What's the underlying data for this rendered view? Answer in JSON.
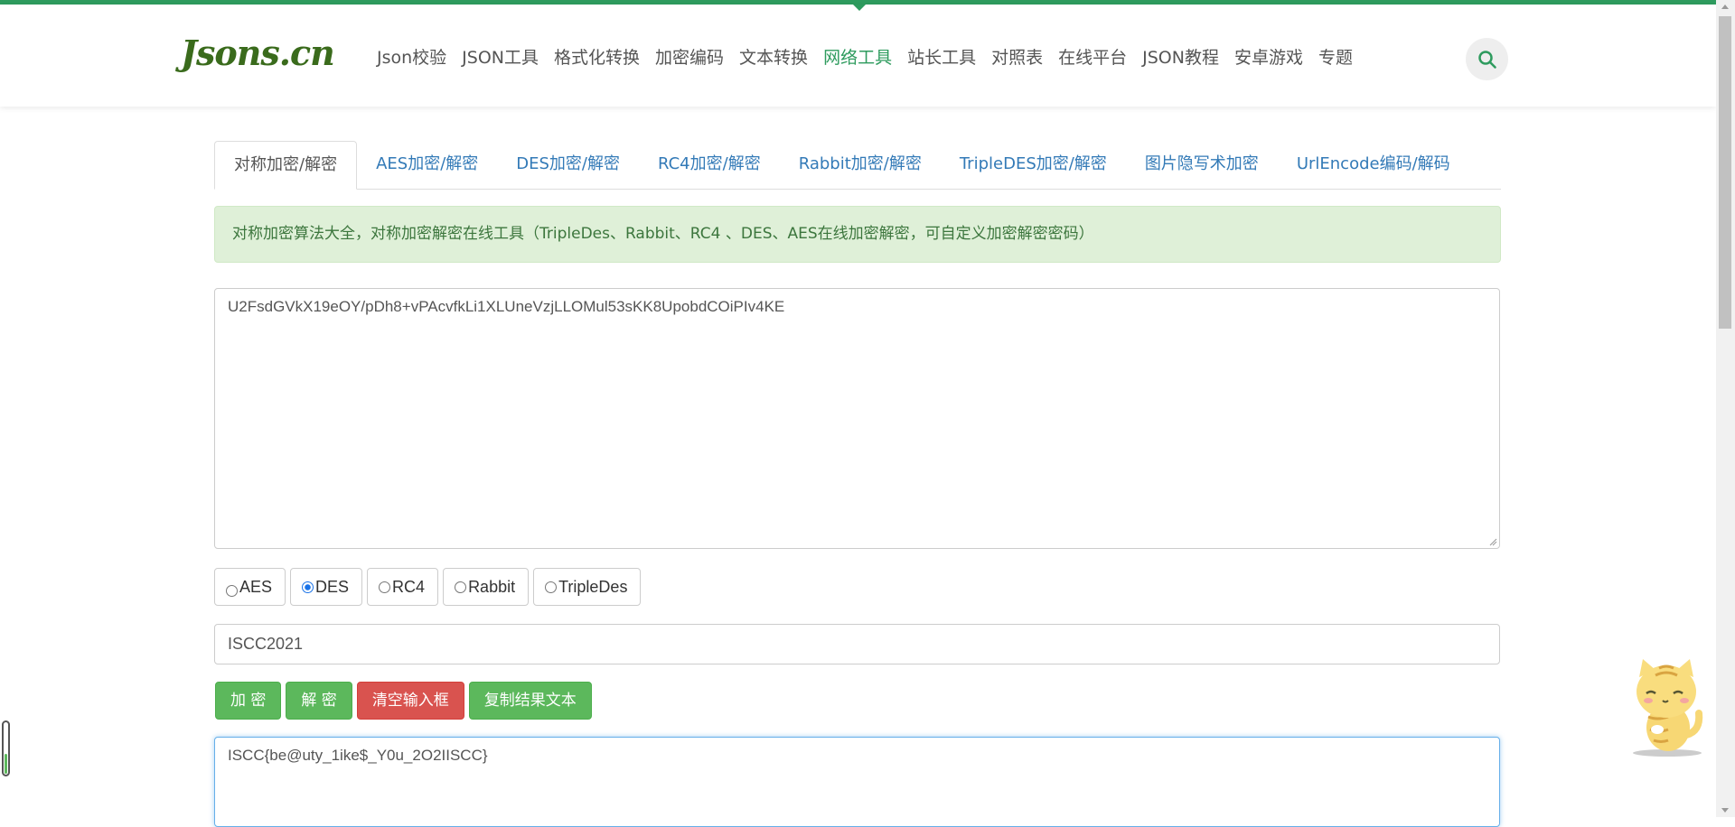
{
  "site": {
    "logo": "Jsons.cn"
  },
  "nav": {
    "items": [
      {
        "label": "Json校验",
        "active": false
      },
      {
        "label": "JSON工具",
        "active": false
      },
      {
        "label": "格式化转换",
        "active": false
      },
      {
        "label": "加密编码",
        "active": false
      },
      {
        "label": "文本转换",
        "active": false
      },
      {
        "label": "网络工具",
        "active": true
      },
      {
        "label": "站长工具",
        "active": false
      },
      {
        "label": "对照表",
        "active": false
      },
      {
        "label": "在线平台",
        "active": false
      },
      {
        "label": "JSON教程",
        "active": false
      },
      {
        "label": "安卓游戏",
        "active": false
      },
      {
        "label": "专题",
        "active": false
      }
    ],
    "search_icon": "search-icon"
  },
  "tabs": [
    {
      "label": "对称加密/解密",
      "active": true
    },
    {
      "label": "AES加密/解密",
      "active": false
    },
    {
      "label": "DES加密/解密",
      "active": false
    },
    {
      "label": "RC4加密/解密",
      "active": false
    },
    {
      "label": "Rabbit加密/解密",
      "active": false
    },
    {
      "label": "TripleDES加密/解密",
      "active": false
    },
    {
      "label": "图片隐写术加密",
      "active": false
    },
    {
      "label": "UrlEncode编码/解码",
      "active": false
    }
  ],
  "alert": {
    "text": "对称加密算法大全，对称加密解密在线工具（TripleDes、Rabbit、RC4 、DES、AES在线加密解密，可自定义加密解密密码）"
  },
  "input": {
    "value": "U2FsdGVkX19eOY/pDh8+vPAcvfkLi1XLUneVzjLLOMul53sKK8UpobdCOiPIv4KE"
  },
  "algorithms": [
    {
      "label": "AES",
      "checked": false
    },
    {
      "label": "DES",
      "checked": true
    },
    {
      "label": "RC4",
      "checked": false
    },
    {
      "label": "Rabbit",
      "checked": false
    },
    {
      "label": "TripleDes",
      "checked": false
    }
  ],
  "password": {
    "value": "ISCC2021"
  },
  "buttons": {
    "encrypt": "加 密",
    "decrypt": "解 密",
    "clear": "清空输入框",
    "copy": "复制结果文本"
  },
  "output": {
    "value": "ISCC{be@uty_1ike$_Y0u_2O2IISCC}"
  },
  "colors": {
    "brand": "#2e9b5e",
    "link": "#337ab7",
    "success": "#5cb85c",
    "danger": "#d9534f",
    "alert_bg": "#dff0d8"
  }
}
